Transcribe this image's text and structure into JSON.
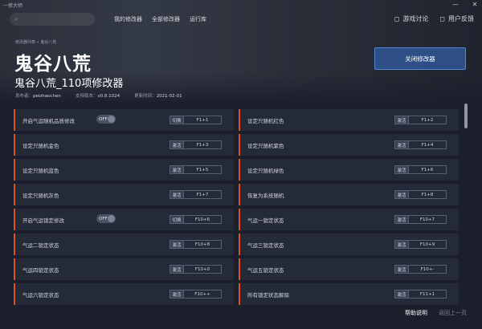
{
  "app_title": "一修大师",
  "window_controls": {
    "minimize": "—",
    "close": "✕"
  },
  "search": {
    "placeholder": "",
    "icon": "search-icon"
  },
  "nav": [
    "我的修改器",
    "全部修改器",
    "运行库"
  ],
  "topright": [
    {
      "icon": "chat-icon",
      "glyph": "◻",
      "label": "游戏讨论"
    },
    {
      "icon": "feedback-icon",
      "glyph": "◻",
      "label": "用户反馈"
    }
  ],
  "breadcrumb": "修改器列表 » 鬼谷八荒",
  "game_title": "鬼谷八荒",
  "sub_title": "鬼谷八荒_110项修改器",
  "meta": {
    "publisher_label": "发布者：",
    "publisher": "peizhaochen",
    "version_label": "支持版本：",
    "version": "v0.8.1024",
    "updated_label": "更新时间：",
    "updated": "2021-02-01"
  },
  "close_button": "关闭修改器",
  "colors": {
    "accent": "#e0531f",
    "primary": "#2e4f85"
  },
  "rows": [
    [
      {
        "label": "开启气运随机品质修改",
        "toggle": "OFF",
        "action": "切换",
        "key": "F1+1"
      },
      {
        "label": "设定只随机红色",
        "toggle": null,
        "action": "激活",
        "key": "F1+2"
      }
    ],
    [
      {
        "label": "设定只随机金色",
        "toggle": null,
        "action": "激活",
        "key": "F1+3"
      },
      {
        "label": "设定只随机紫色",
        "toggle": null,
        "action": "激活",
        "key": "F1+4"
      }
    ],
    [
      {
        "label": "设定只随机蓝色",
        "toggle": null,
        "action": "激活",
        "key": "F1+5"
      },
      {
        "label": "设定只随机绿色",
        "toggle": null,
        "action": "激活",
        "key": "F1+6"
      }
    ],
    [
      {
        "label": "设定只随机灰色",
        "toggle": null,
        "action": "激活",
        "key": "F1+7"
      },
      {
        "label": "恢复为系统随机",
        "toggle": null,
        "action": "激活",
        "key": "F1+8"
      }
    ],
    [
      {
        "label": "开启气运锁定修改",
        "toggle": "OFF",
        "action": "切换",
        "key": "F10+6"
      },
      {
        "label": "气运一锁定状态",
        "toggle": null,
        "action": "激活",
        "key": "F10+7"
      }
    ],
    [
      {
        "label": "气运二锁定状态",
        "toggle": null,
        "action": "激活",
        "key": "F10+8"
      },
      {
        "label": "气运三锁定状态",
        "toggle": null,
        "action": "激活",
        "key": "F10+9"
      }
    ],
    [
      {
        "label": "气运四锁定状态",
        "toggle": null,
        "action": "激活",
        "key": "F10+0"
      },
      {
        "label": "气运五锁定状态",
        "toggle": null,
        "action": "激活",
        "key": "F10+-"
      }
    ],
    [
      {
        "label": "气运六锁定状态",
        "toggle": null,
        "action": "激活",
        "key": "F10++"
      },
      {
        "label": "所有锁定状态解除",
        "toggle": null,
        "action": "激活",
        "key": "F11+1"
      }
    ]
  ],
  "footer": {
    "help": "帮助说明",
    "back": "返回上一页"
  }
}
